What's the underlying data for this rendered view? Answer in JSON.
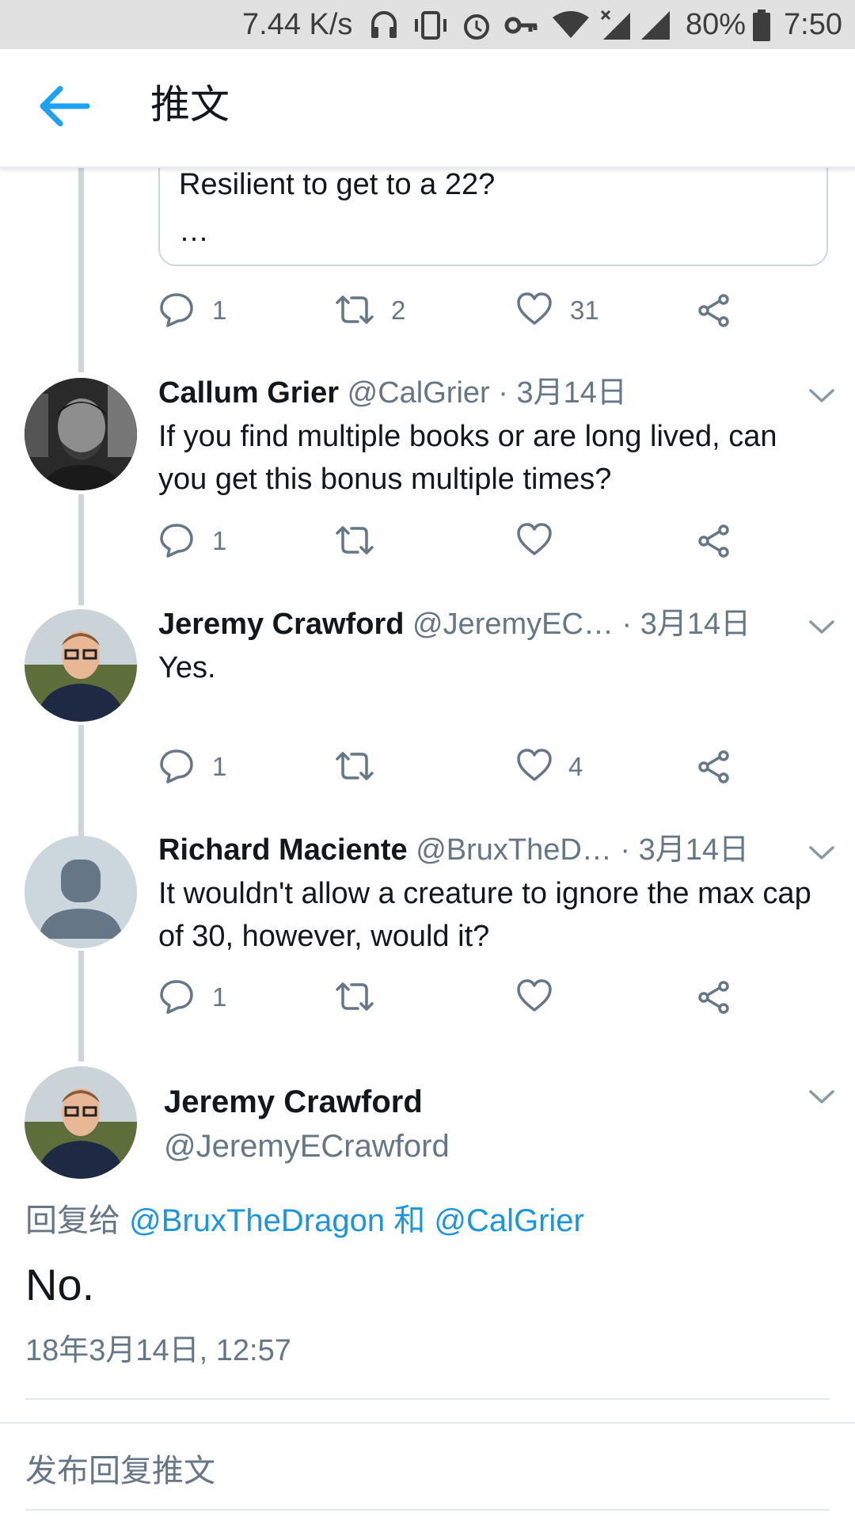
{
  "status_bar": {
    "speed": "7.44 K/s",
    "battery": "80%",
    "time": "7:50",
    "icons": [
      "headphones-icon",
      "vibrate-icon",
      "alarm-icon",
      "vpn-key-icon",
      "wifi-icon",
      "no-sim-signal-icon",
      "signal-icon",
      "battery-icon"
    ]
  },
  "header": {
    "title": "推文",
    "back_icon": "arrow-left-icon"
  },
  "quote": {
    "line1": "Resilient to get to a 22?",
    "line2": "…"
  },
  "actions0": {
    "reply": "1",
    "retweet": "2",
    "like": "31"
  },
  "tweets": [
    {
      "name": "Callum Grier",
      "handle": "@CalGrier",
      "date": "· 3月14日",
      "text": "If you find multiple books or are long lived, can you get this bonus multiple times?",
      "reply": "1",
      "retweet": "",
      "like": ""
    },
    {
      "name": "Jeremy Crawford",
      "handle": "@JeremyEC…",
      "date": "· 3月14日",
      "text": "Yes.",
      "reply": "1",
      "retweet": "",
      "like": "4"
    },
    {
      "name": "Richard Maciente",
      "handle": "@BruxTheD…",
      "date": "· 3月14日",
      "text": "It wouldn't allow a creature to ignore the max cap of 30, however, would it?",
      "reply": "1",
      "retweet": "",
      "like": ""
    }
  ],
  "focused": {
    "name": "Jeremy Crawford",
    "handle": "@JeremyECrawford",
    "reply_prefix": "回复给",
    "mention1": "@BruxTheDragon",
    "and": "和",
    "mention2": "@CalGrier",
    "text": "No.",
    "timestamp": "18年3月14日, 12:57"
  },
  "compose": {
    "placeholder": "发布回复推文"
  },
  "colors": {
    "accent": "#1b95e0",
    "secondary_text": "#657786",
    "thread_line": "#ccd6dd"
  }
}
